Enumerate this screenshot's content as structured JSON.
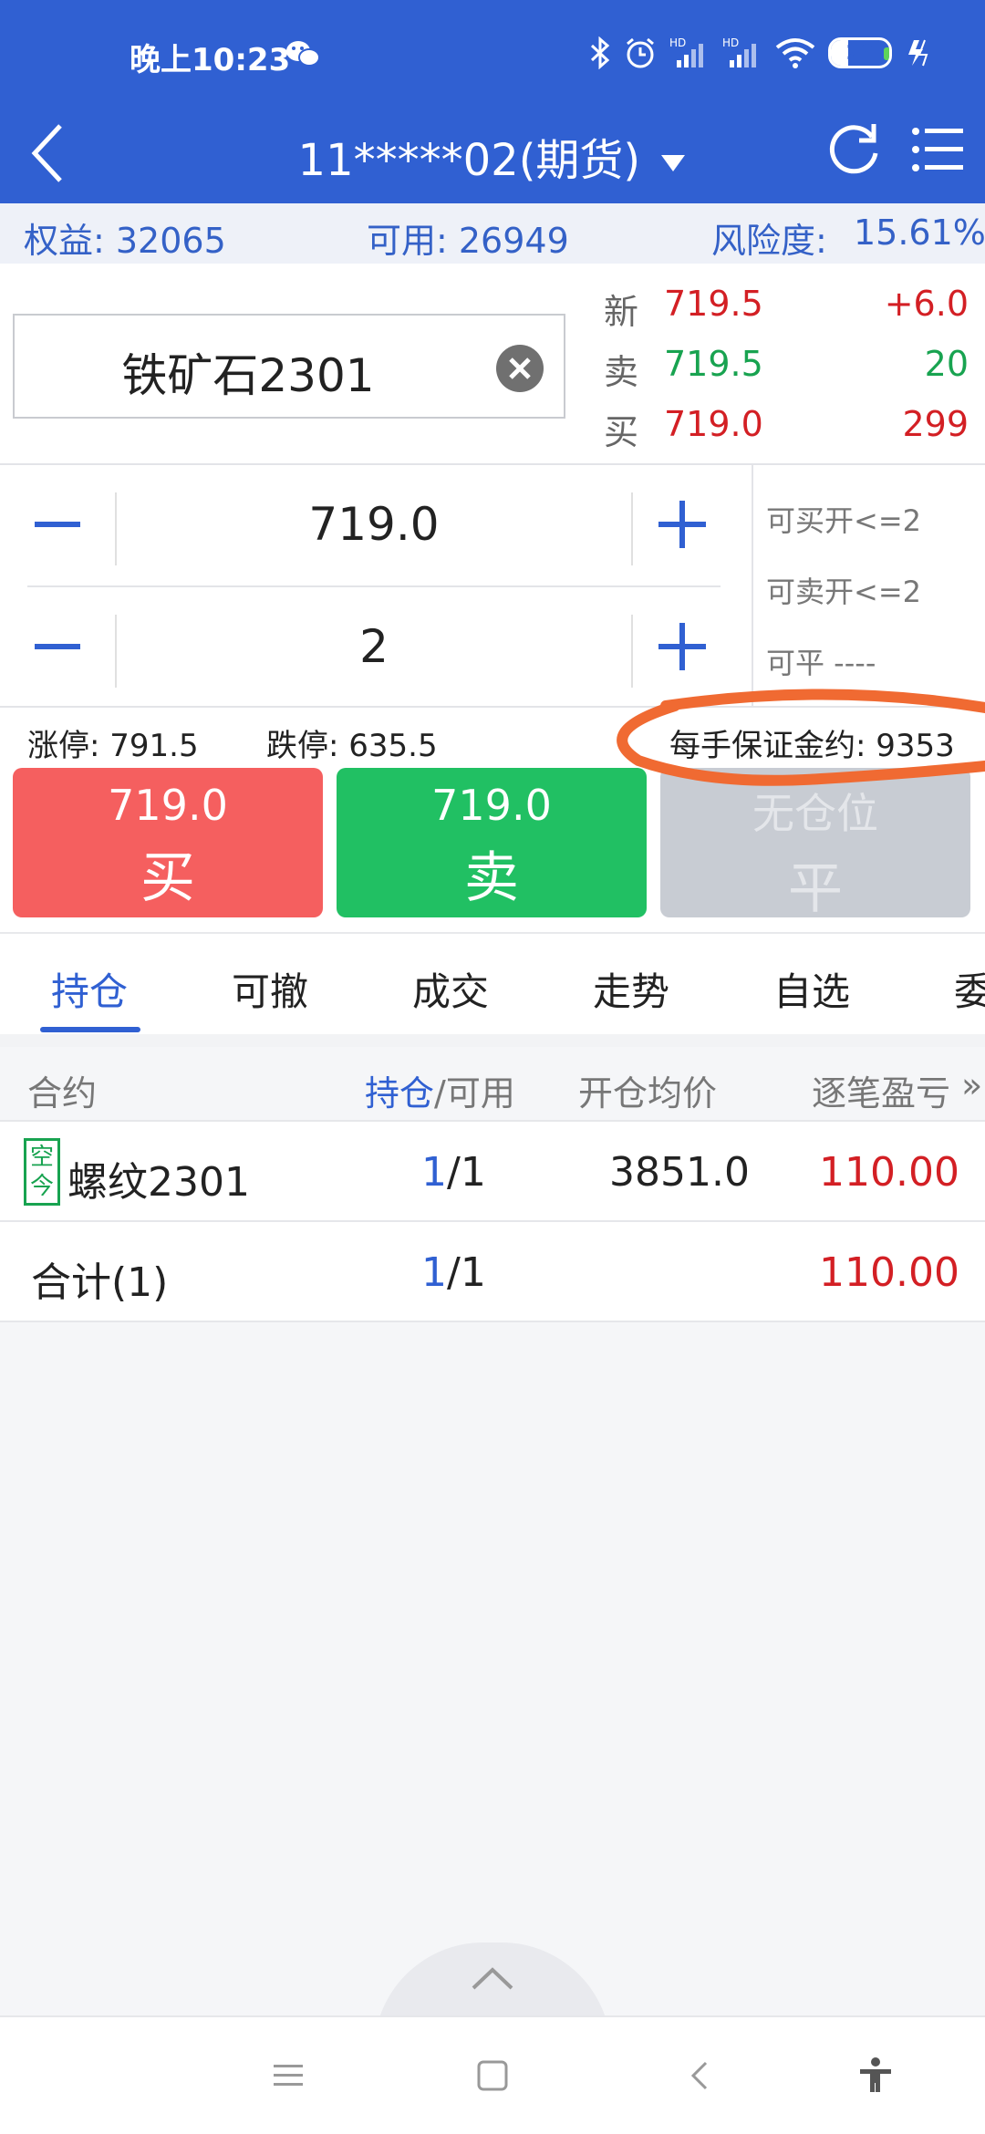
{
  "status_bar": {
    "time": "晚上10:23",
    "battery": "29"
  },
  "header": {
    "title": "11*****02(期货)"
  },
  "account": {
    "equity": "权益: 32065",
    "available": "可用: 26949",
    "risk_label": "风险度:",
    "risk_value": "15.61%"
  },
  "symbol": {
    "name": "铁矿石2301"
  },
  "quote": {
    "last": {
      "label": "新",
      "price": "719.5",
      "value": "+6.0"
    },
    "ask": {
      "label": "卖",
      "price": "719.5",
      "value": "20"
    },
    "bid": {
      "label": "买",
      "price": "719.0",
      "value": "299"
    }
  },
  "order": {
    "price": "719.0",
    "quantity": "2",
    "can_buy_open": "可买开<=2",
    "can_sell_open": "可卖开<=2",
    "can_close": "可平 ----"
  },
  "limits": {
    "limit_up": "涨停: 791.5",
    "limit_down": "跌停: 635.5",
    "margin": "每手保证金约: 9353"
  },
  "actions": {
    "buy": {
      "price": "719.0",
      "label": "买"
    },
    "sell": {
      "price": "719.0",
      "label": "卖"
    },
    "close": {
      "price": "无仓位",
      "label": "平"
    }
  },
  "tabs": [
    "持仓",
    "可撤",
    "成交",
    "走势",
    "自选",
    "委"
  ],
  "table": {
    "headers": {
      "contract": "合约",
      "position": "持仓",
      "sep_available": "/可用",
      "avg_price": "开仓均价",
      "pnl": "逐笔盈亏",
      "more": "»"
    },
    "rows": [
      {
        "tag_top": "空",
        "tag_bottom": "今",
        "contract": "螺纹2301",
        "position": "1",
        "available": "/1",
        "avg_price": "3851.0",
        "pnl": "110.00"
      }
    ],
    "total": {
      "label": "合计(1)",
      "position": "1",
      "available": "/1",
      "pnl": "110.00"
    }
  },
  "colors": {
    "primary": "#3060d2",
    "buy": "#f55f5f",
    "sell": "#21c063",
    "disabled": "#c8ccd3",
    "up": "#d31f24",
    "down": "#18a350",
    "annotation": "#f06a32"
  }
}
